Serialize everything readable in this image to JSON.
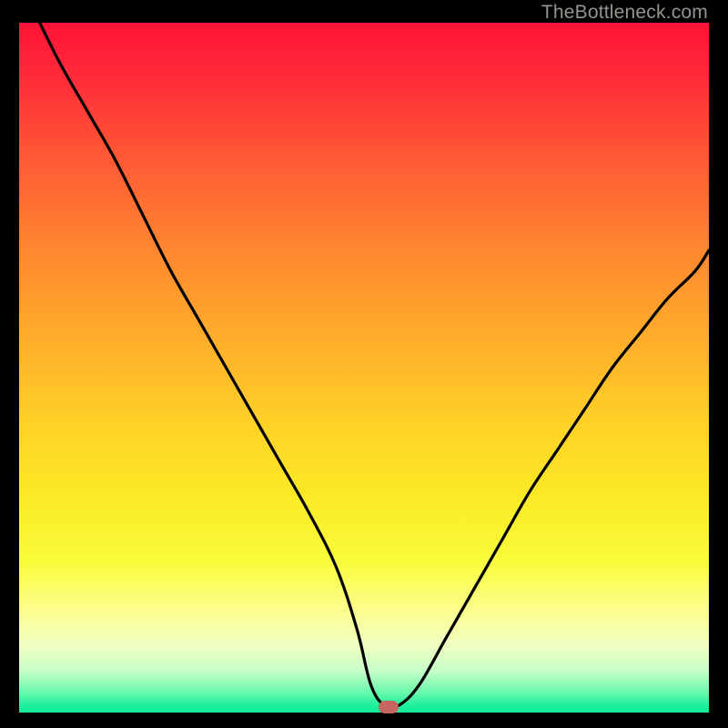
{
  "watermark": "TheBottleneck.com",
  "colors": {
    "frame": "#000000",
    "marker": "#c76660",
    "curve": "#000000"
  },
  "chart_data": {
    "type": "line",
    "title": "",
    "xlabel": "",
    "ylabel": "",
    "xlim": [
      0,
      100
    ],
    "ylim": [
      0,
      100
    ],
    "grid": false,
    "legend": false,
    "note": "Values are read off the rendered curve as percentage of plot width (x) and height from bottom (y).",
    "series": [
      {
        "name": "bottleneck-curve",
        "x": [
          3,
          6,
          10,
          14,
          18,
          22,
          26,
          30,
          34,
          38,
          42,
          46,
          49,
          51,
          53,
          55,
          58,
          62,
          66,
          70,
          74,
          78,
          82,
          86,
          90,
          94,
          98,
          100
        ],
        "y": [
          100,
          94,
          87,
          80,
          72,
          64,
          57,
          50,
          43,
          36,
          29,
          21,
          12,
          4,
          1,
          1,
          4,
          11,
          18,
          25,
          32,
          38,
          44,
          50,
          55,
          60,
          64,
          67
        ]
      }
    ],
    "marker": {
      "x": 53.5,
      "y": 0.5
    },
    "background_gradient": [
      {
        "stop": 0,
        "color": "#ff1338"
      },
      {
        "stop": 20,
        "color": "#ff5a35"
      },
      {
        "stop": 45,
        "color": "#ffab2c"
      },
      {
        "stop": 68,
        "color": "#fbe825"
      },
      {
        "stop": 85,
        "color": "#fcfe8c"
      },
      {
        "stop": 94,
        "color": "#c6ffc8"
      },
      {
        "stop": 100,
        "color": "#17ee9a"
      }
    ]
  }
}
